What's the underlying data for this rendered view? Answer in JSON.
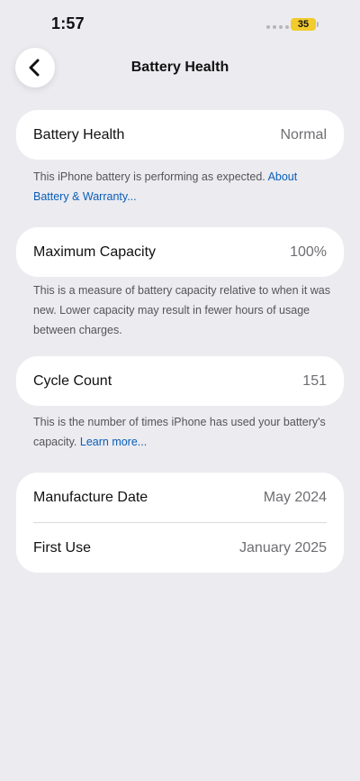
{
  "status_bar": {
    "time": "1:57",
    "battery_level": "35",
    "battery_color": "#F2CB2C"
  },
  "nav": {
    "title": "Battery Health",
    "back_icon": "chevron-left-icon"
  },
  "sections": {
    "health": {
      "label": "Battery Health",
      "value": "Normal",
      "footnote": "This iPhone battery is performing as expected. ",
      "footnote_link": "About Battery & Warranty..."
    },
    "capacity": {
      "label": "Maximum Capacity",
      "value": "100%",
      "footnote": "This is a measure of battery capacity relative to when it was new. Lower capacity may result in fewer hours of usage between charges."
    },
    "cycles": {
      "label": "Cycle Count",
      "value": "151",
      "footnote": "This is the number of times iPhone has used your battery's capacity. ",
      "footnote_link": "Learn more..."
    },
    "dates": {
      "manufacture_label": "Manufacture Date",
      "manufacture_value": "May 2024",
      "first_use_label": "First Use",
      "first_use_value": "January 2025"
    }
  },
  "colors": {
    "background": "#EBEBF0",
    "link": "#0A5EB8"
  }
}
